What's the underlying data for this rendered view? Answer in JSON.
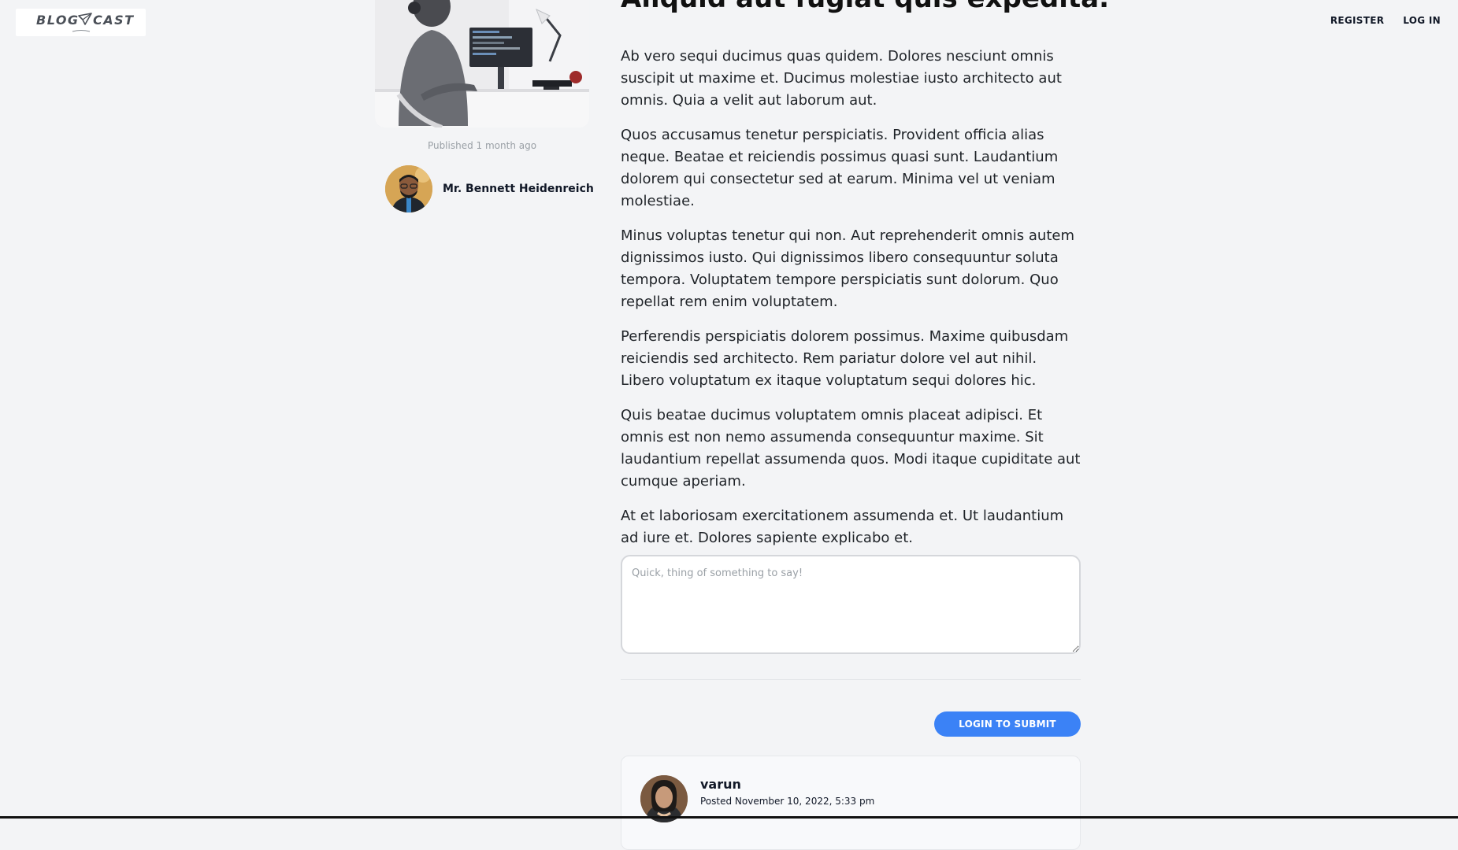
{
  "header": {
    "logo_text": "BLOG CAST",
    "nav": {
      "register": "REGISTER",
      "login": "LOG IN"
    }
  },
  "post": {
    "title": "Aliquid aut fugiat quis expedita.",
    "published": "Published 1 month ago",
    "author_name": "Mr. Bennett Heidenreich",
    "paragraphs": [
      "Ab vero sequi ducimus quas quidem. Dolores nesciunt omnis suscipit ut maxime et. Ducimus molestiae iusto architecto aut omnis. Quia a velit aut laborum aut.",
      "Quos accusamus tenetur perspiciatis. Provident officia alias neque. Beatae et reiciendis possimus quasi sunt. Laudantium dolorem qui consectetur sed at earum. Minima vel ut veniam molestiae.",
      "Minus voluptas tenetur qui non. Aut reprehenderit omnis autem dignissimos iusto. Qui dignissimos libero consequuntur soluta tempora. Voluptatem tempore perspiciatis sunt dolorum. Quo repellat rem enim voluptatem.",
      "Perferendis perspiciatis dolorem possimus. Maxime quibusdam reiciendis sed architecto. Rem pariatur dolore vel aut nihil. Libero voluptatum ex itaque voluptatum sequi dolores hic.",
      "Quis beatae ducimus voluptatem omnis placeat adipisci. Et omnis est non nemo assumenda consequuntur maxime. Sit laudantium repellat assumenda quos. Modi itaque cupiditate aut cumque aperiam.",
      "At et laboriosam exercitationem assumenda et. Ut laudantium ad iure et. Dolores sapiente explicabo et."
    ]
  },
  "comment_form": {
    "placeholder": "Quick, thing of something to say!",
    "value": "",
    "submit_label": "LOGIN TO SUBMIT"
  },
  "comments": [
    {
      "author": "varun",
      "posted": "Posted November 10, 2022, 5:33 pm"
    }
  ],
  "colors": {
    "page_bg": "#f3f4f6",
    "accent": "#3b82f6",
    "text": "#1f2328",
    "muted": "#9aa0a6"
  }
}
